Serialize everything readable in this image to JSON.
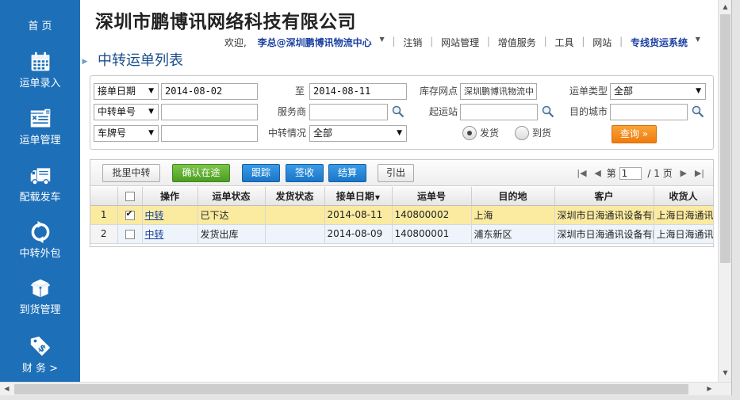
{
  "header": {
    "company_title": "深圳市鹏博讯网络科技有限公司",
    "page_title": "中转运单列表"
  },
  "topnav": {
    "welcome": "欢迎,",
    "user": "李总@深圳鹏博讯物流中心",
    "links": [
      "注销",
      "网站管理",
      "增值服务",
      "工具",
      "网站"
    ],
    "system": "专线货运系统"
  },
  "sidebar": {
    "items": [
      {
        "label": "首 页",
        "icon": "home"
      },
      {
        "label": "运单录入",
        "icon": "calendar-icon"
      },
      {
        "label": "运单管理",
        "icon": "waybill-icon"
      },
      {
        "label": "配载发车",
        "icon": "truck-icon"
      },
      {
        "label": "中转外包",
        "icon": "refresh-icon"
      },
      {
        "label": "到货管理",
        "icon": "package-icon"
      },
      {
        "label": "财 务 >",
        "icon": "price-tag-icon"
      }
    ]
  },
  "filters": {
    "date_type": "接单日期",
    "date_from": "2014-08-02",
    "to_label": "至",
    "date_to": "2014-08-11",
    "warehouse_label": "库存网点",
    "warehouse_value": "深圳鹏博讯物流中",
    "waybill_type_label": "运单类型",
    "waybill_type_value": "全部",
    "transfer_no_type": "中转单号",
    "transfer_no_value": "",
    "provider_label": "服务商",
    "provider_value": "",
    "origin_label": "起运站",
    "origin_value": "",
    "dest_city_label": "目的城市",
    "dest_city_value": "",
    "plate_type": "车牌号",
    "plate_value": "",
    "transfer_status_label": "中转情况",
    "transfer_status_value": "全部",
    "radio_ship": "发货",
    "radio_arrive": "到货",
    "query_button": "查询 »"
  },
  "toolbar": {
    "batch_transfer": "批里中转",
    "confirm_transit": "确认在途",
    "track": "跟踪",
    "sign": "签收",
    "settle": "结算",
    "export": "引出"
  },
  "pager": {
    "prefix": "第",
    "page": "1",
    "total": "/ 1 页"
  },
  "table": {
    "columns": [
      "",
      "",
      "操作",
      "运单状态",
      "发货状态",
      "接单日期",
      "运单号",
      "目的地",
      "客户",
      "收货人"
    ],
    "rows": [
      {
        "idx": "1",
        "checked": true,
        "op": "中转",
        "status": "已下达",
        "ship_status": "",
        "date": "2014-08-11",
        "waybill_no": "140800002",
        "dest": "上海",
        "customer": "深圳市日海通讯设备有限公司",
        "receiver": "上海日海通讯有限公司"
      },
      {
        "idx": "2",
        "checked": false,
        "op": "中转",
        "status": "发货出库",
        "ship_status": "",
        "date": "2014-08-09",
        "waybill_no": "140800001",
        "dest": "浦东新区",
        "customer": "深圳市日海通讯设备有限公司",
        "receiver": "上海日海通讯有限公司"
      }
    ]
  },
  "colors": {
    "sidebar_bg": "#1d6fb8",
    "selected_row": "#fbeba1",
    "alt_row": "#eef4fb",
    "query_orange": "#ef7c0c",
    "green_button": "#4c9e22",
    "blue_button": "#1a76c8",
    "nav_blue": "#1a3fa0"
  }
}
